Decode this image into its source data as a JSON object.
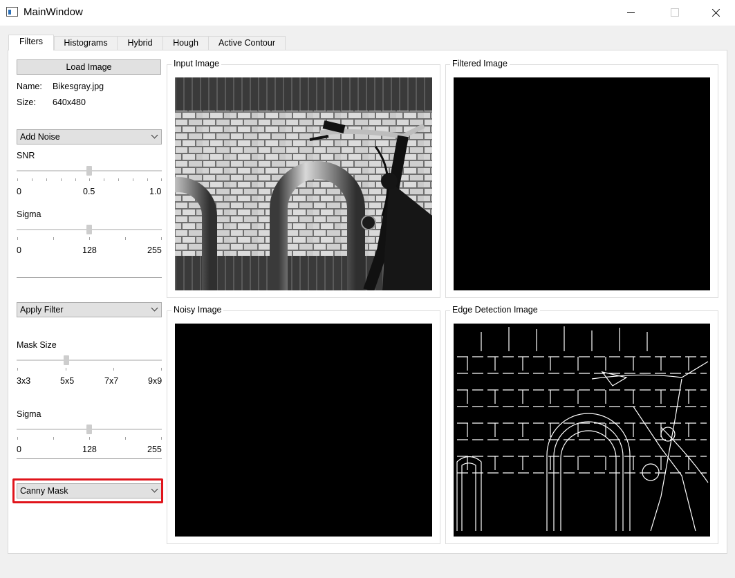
{
  "window": {
    "title": "MainWindow"
  },
  "tabs": [
    "Filters",
    "Histograms",
    "Hybrid",
    "Hough",
    "Active Contour"
  ],
  "left": {
    "load_button": "Load Image",
    "name_label": "Name:",
    "name_value": "Bikesgray.jpg",
    "size_label": "Size:",
    "size_value": "640x480",
    "noise_combo": "Add Noise",
    "snr": {
      "label": "SNR",
      "min": "0",
      "mid": "0.5",
      "max": "1.0",
      "value": 0.5
    },
    "sigma1": {
      "label": "Sigma",
      "min": "0",
      "mid": "128",
      "max": "255",
      "value": 128
    },
    "filter_combo": "Apply Filter",
    "mask_size": {
      "label": "Mask Size",
      "t1": "3x3",
      "t2": "5x5",
      "t3": "7x7",
      "t4": "9x9",
      "value": "5x5"
    },
    "sigma2": {
      "label": "Sigma",
      "min": "0",
      "mid": "128",
      "max": "255",
      "value": 128
    },
    "edge_combo": "Canny Mask"
  },
  "panels": {
    "input": "Input Image",
    "filtered": "Filtered Image",
    "noisy": "Noisy Image",
    "edge": "Edge Detection Image"
  },
  "colors": {
    "highlight": "#e0141b",
    "panel_bg": "#ffffff",
    "window_bg": "#f0f0f0"
  }
}
